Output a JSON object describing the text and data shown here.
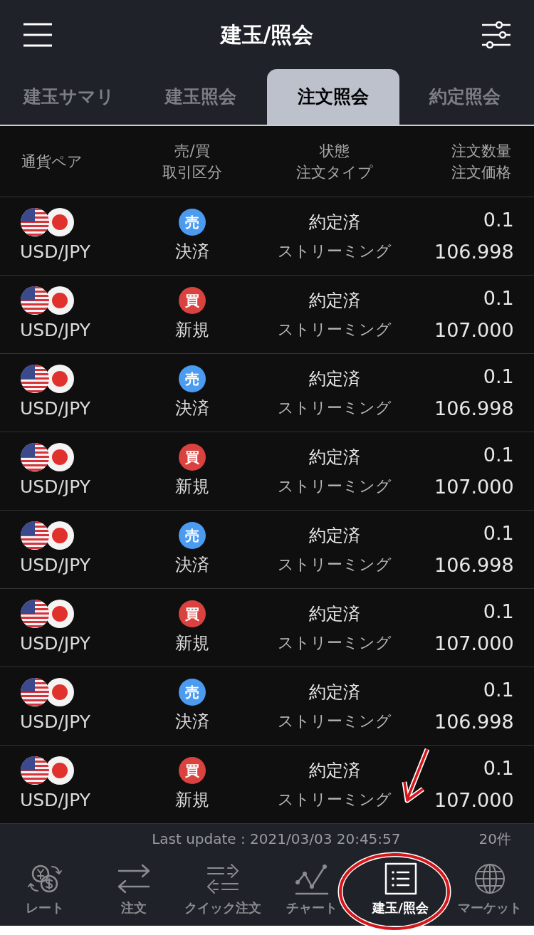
{
  "header": {
    "title": "建玉/照会"
  },
  "tabs": [
    {
      "label": "建玉サマリ",
      "selected": false
    },
    {
      "label": "建玉照会",
      "selected": false
    },
    {
      "label": "注文照会",
      "selected": true
    },
    {
      "label": "約定照会",
      "selected": false
    }
  ],
  "table": {
    "columns": [
      [
        "通貨ペア"
      ],
      [
        "売/買",
        "取引区分"
      ],
      [
        "状態",
        "注文タイプ"
      ],
      [
        "注文数量",
        "注文価格"
      ]
    ],
    "rows": [
      {
        "pair": "USD/JPY",
        "kind": "sell",
        "side_label": "売",
        "category": "決済",
        "status": "約定済",
        "order_type": "ストリーミング",
        "quantity": "0.1",
        "price": "106.998"
      },
      {
        "pair": "USD/JPY",
        "kind": "buy",
        "side_label": "買",
        "category": "新規",
        "status": "約定済",
        "order_type": "ストリーミング",
        "quantity": "0.1",
        "price": "107.000"
      },
      {
        "pair": "USD/JPY",
        "kind": "sell",
        "side_label": "売",
        "category": "決済",
        "status": "約定済",
        "order_type": "ストリーミング",
        "quantity": "0.1",
        "price": "106.998"
      },
      {
        "pair": "USD/JPY",
        "kind": "buy",
        "side_label": "買",
        "category": "新規",
        "status": "約定済",
        "order_type": "ストリーミング",
        "quantity": "0.1",
        "price": "107.000"
      },
      {
        "pair": "USD/JPY",
        "kind": "sell",
        "side_label": "売",
        "category": "決済",
        "status": "約定済",
        "order_type": "ストリーミング",
        "quantity": "0.1",
        "price": "106.998"
      },
      {
        "pair": "USD/JPY",
        "kind": "buy",
        "side_label": "買",
        "category": "新規",
        "status": "約定済",
        "order_type": "ストリーミング",
        "quantity": "0.1",
        "price": "107.000"
      },
      {
        "pair": "USD/JPY",
        "kind": "sell",
        "side_label": "売",
        "category": "決済",
        "status": "約定済",
        "order_type": "ストリーミング",
        "quantity": "0.1",
        "price": "106.998"
      },
      {
        "pair": "USD/JPY",
        "kind": "buy",
        "side_label": "買",
        "category": "新規",
        "status": "約定済",
        "order_type": "ストリーミング",
        "quantity": "0.1",
        "price": "107.000"
      }
    ]
  },
  "footer": {
    "last_update": "Last update : 2021/03/03 20:45:57",
    "count": "20件"
  },
  "bottom_nav": [
    {
      "kind": "rate",
      "label": "レート",
      "selected": false
    },
    {
      "kind": "order",
      "label": "注文",
      "selected": false
    },
    {
      "kind": "quick",
      "label": "クイック注文",
      "selected": false
    },
    {
      "kind": "chart",
      "label": "チャート",
      "selected": false
    },
    {
      "kind": "positions",
      "label": "建玉/照会",
      "selected": true
    },
    {
      "kind": "market",
      "label": "マーケット",
      "selected": false
    }
  ]
}
